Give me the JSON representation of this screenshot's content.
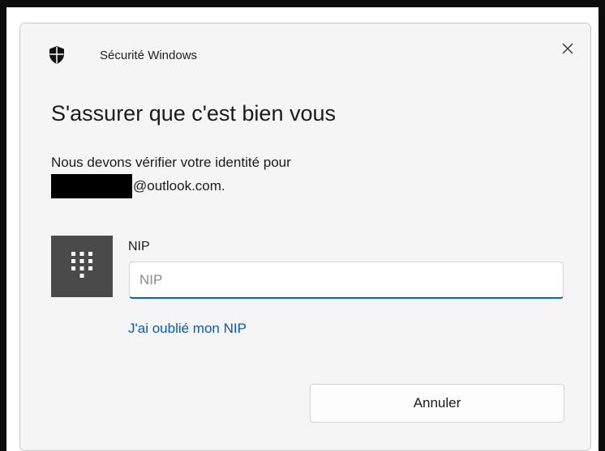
{
  "window": {
    "title": "Sécurité Windows",
    "title_icon": "shield-icon",
    "close_icon": "close-icon"
  },
  "main": {
    "heading": "S'assurer que c'est bien vous",
    "description": "Nous devons vérifier votre identité pour",
    "account_domain": "@outlook.com."
  },
  "pin": {
    "tile_icon": "keypad-icon",
    "label": "NIP",
    "placeholder": "NIP",
    "value": ""
  },
  "links": {
    "forgot_pin": "J'ai oublié mon NIP"
  },
  "buttons": {
    "cancel": "Annuler"
  },
  "colors": {
    "accent": "#0067c0",
    "link": "#0a58b8",
    "tile_bg": "#4a4a4a",
    "dialog_bg": "#f5f5f5"
  }
}
